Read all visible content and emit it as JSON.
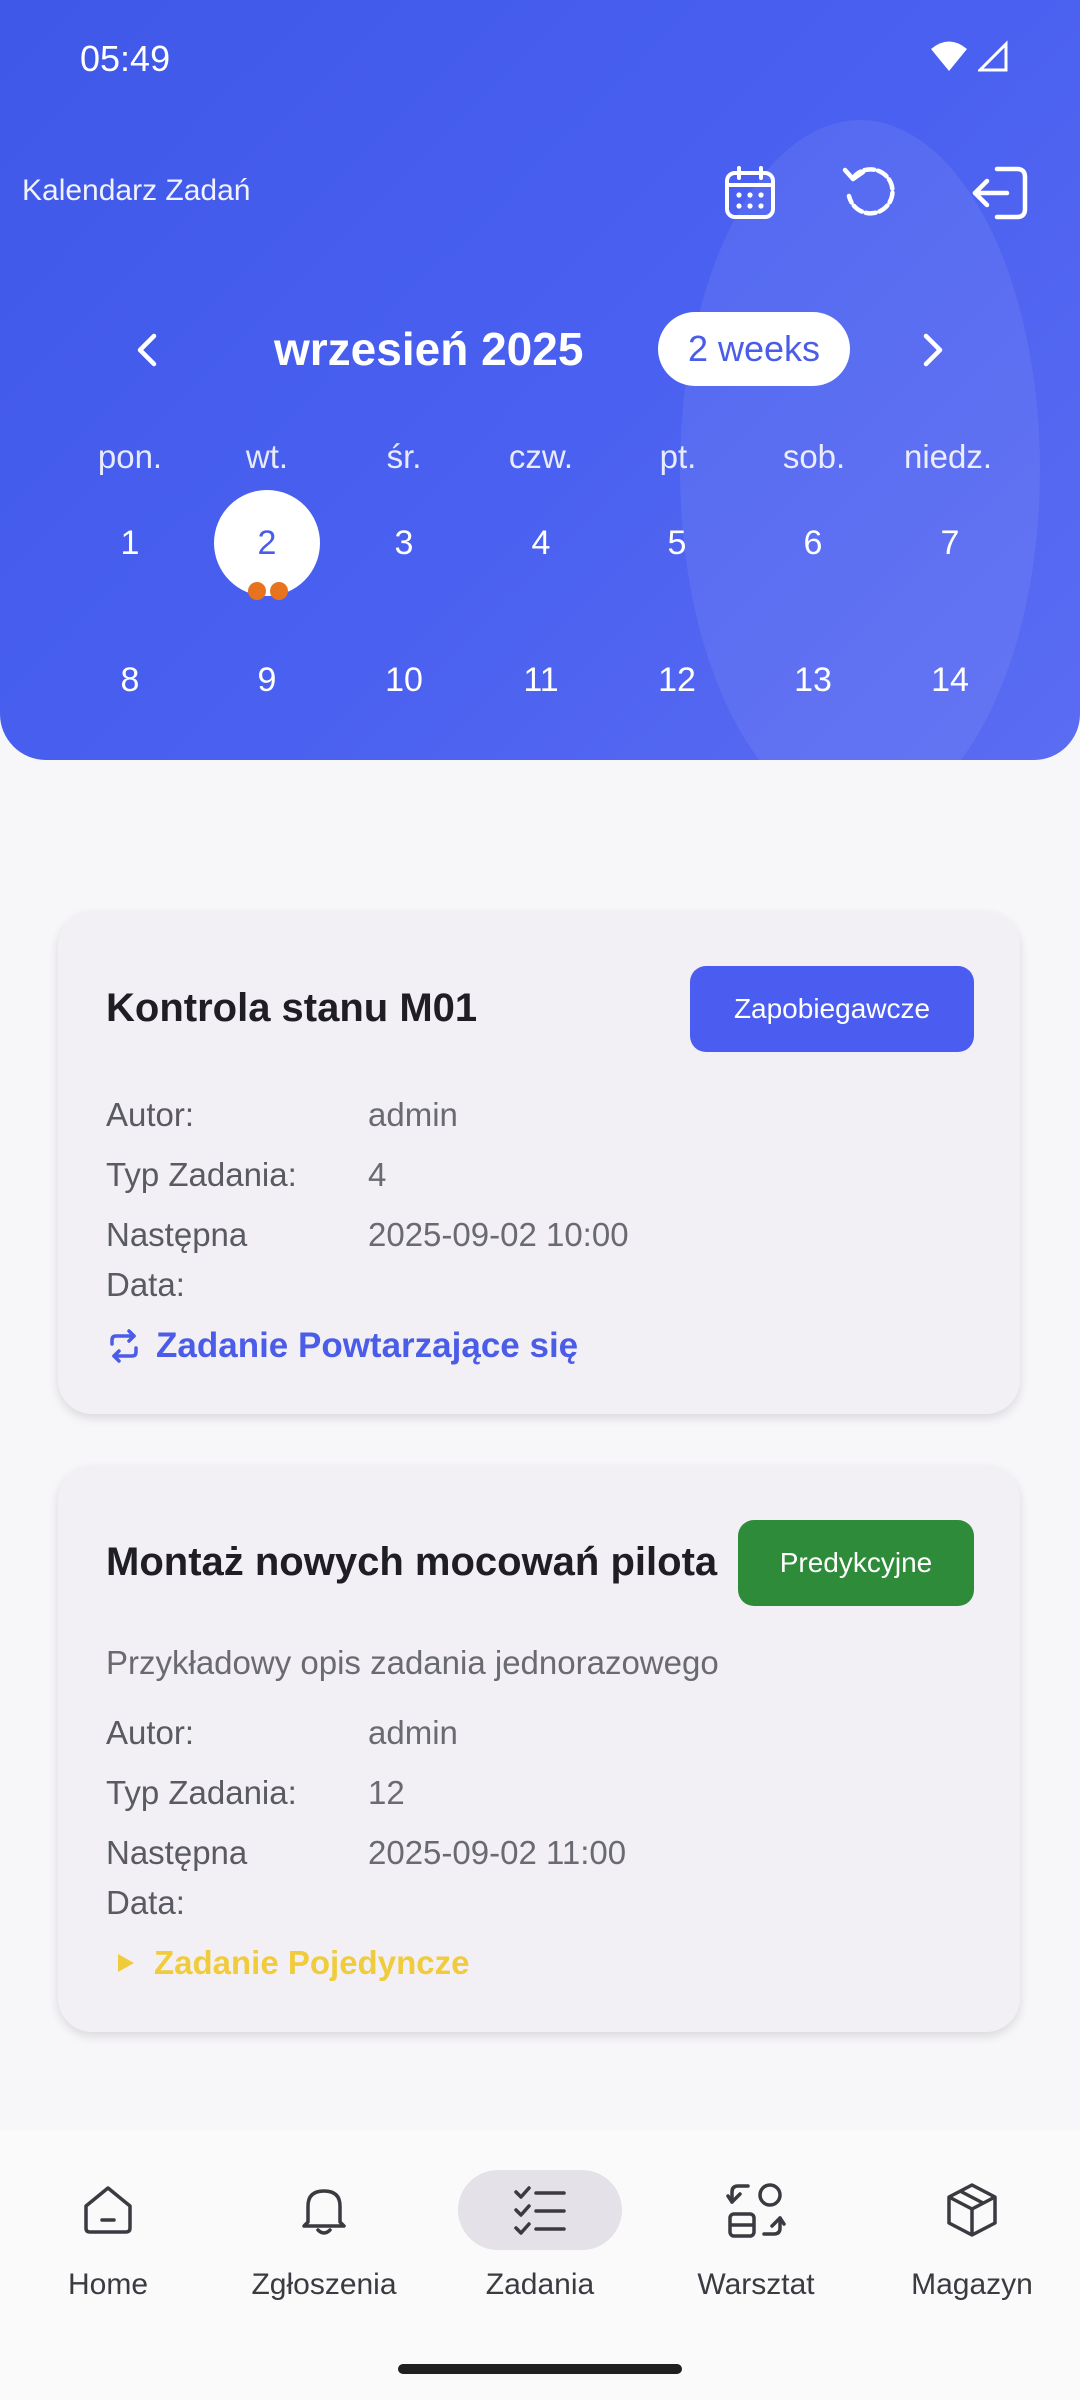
{
  "status_bar": {
    "time": "05:49"
  },
  "header": {
    "title": "Kalendarz Zadań",
    "month": "wrzesień 2025",
    "format_button": "2 weeks"
  },
  "calendar": {
    "weekdays": [
      "pon.",
      "wt.",
      "śr.",
      "czw.",
      "pt.",
      "sob.",
      "niedz."
    ],
    "week1": [
      "1",
      "2",
      "3",
      "4",
      "5",
      "6",
      "7"
    ],
    "week2": [
      "8",
      "9",
      "10",
      "11",
      "12",
      "13",
      "14"
    ],
    "selected_day": "2",
    "event_markers_on_selected": 2
  },
  "tasks": [
    {
      "title": "Kontrola stanu M01",
      "badge": "Zapobiegawcze",
      "badge_color": "#4b5df0",
      "author_label": "Autor:",
      "author": "admin",
      "type_label": "Typ Zadania:",
      "type": "4",
      "next_label_line1": "Następna",
      "next_label_line2": "Data:",
      "next_date": "2025-09-02 10:00",
      "footer": "Zadanie Powtarzające się",
      "footer_icon": "repeat-icon"
    },
    {
      "title": "Montaż nowych mocowań pilota",
      "badge": "Predykcyjne",
      "badge_color": "#2e8b3a",
      "description": "Przykładowy opis zadania jednorazowego",
      "author_label": "Autor:",
      "author": "admin",
      "type_label": "Typ Zadania:",
      "type": "12",
      "next_label_line1": "Następna",
      "next_label_line2": "Data:",
      "next_date": "2025-09-02 11:00",
      "footer": "Zadanie Pojedyncze",
      "footer_icon": "play-icon"
    }
  ],
  "bottom_nav": [
    {
      "label": "Home",
      "icon": "home-icon"
    },
    {
      "label": "Zgłoszenia",
      "icon": "bell-icon"
    },
    {
      "label": "Zadania",
      "icon": "checklist-icon",
      "active": true
    },
    {
      "label": "Warsztat",
      "icon": "workshop-icon"
    },
    {
      "label": "Magazyn",
      "icon": "box-icon"
    }
  ]
}
